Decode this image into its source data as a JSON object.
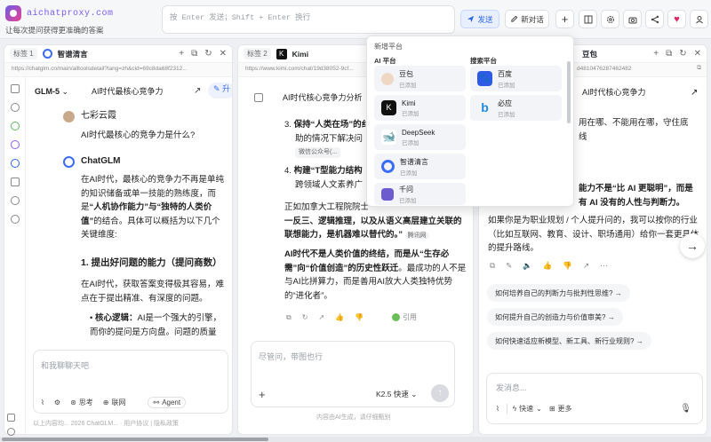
{
  "header": {
    "brand": "aichatproxy.com",
    "tagline": "让每次提问获得更准确的答案",
    "prompt_placeholder": "按 Enter 发送；Shift + Enter 换行",
    "send_label": "发送",
    "new_chat_label": "新对话"
  },
  "dropdown": {
    "title": "新增平台",
    "ai_section": "AI 平台",
    "search_section": "搜索平台",
    "ai_items": [
      {
        "name": "豆包",
        "status": "已添加"
      },
      {
        "name": "Kimi",
        "status": "已添加"
      },
      {
        "name": "DeepSeek",
        "status": "已添加"
      },
      {
        "name": "智谱清言",
        "status": "已添加"
      },
      {
        "name": "千问",
        "status": "已添加"
      }
    ],
    "search_items": [
      {
        "name": "百度",
        "status": "已添加"
      },
      {
        "name": "必应",
        "status": "已添加"
      }
    ]
  },
  "panel1": {
    "tag": "标签 1",
    "title": "智谱清言",
    "url": "https://chatglm.cn/main/alltoolsdetail?lang=zh&cid=69c8da68f2312...",
    "model": "GLM-5",
    "conv_title": "AI时代最核心竞争力",
    "user_name": "七彩云霞",
    "user_question": "AI时代最核心的竞争力是什么?",
    "bot_name": "ChatGLM",
    "p1_a": "在AI时代，最核心的竞争力不再是单纯的知识储备或单一技能的熟练度，而是",
    "p1_b": "“人机协作能力”与“独特的人类价值”",
    "p1_c": "的结合。具体可以概括为以下几个关键维度:",
    "h1": "1. 提出好问题的能力（提问商数）",
    "p2": "在AI时代，获取答案变得极其容易，难点在于提出精准、有深度的问题。",
    "bullet_label": "核心逻辑：",
    "bullet_text": "AI是一个强大的引擎，而你的提问是方向盘。问题的质量",
    "input_placeholder": "和我聊聊天吧",
    "chip_think": "思考",
    "chip_web": "联网",
    "chip_agent": "Agent",
    "footer": "以上内容均... 2026 ChatGLM... · 用户协议 | 隐私政策"
  },
  "panel2": {
    "tag": "标签 2",
    "title": "Kimi",
    "url": "https://www.kimi.com/chat/19d38052-9cf...",
    "conv_title": "AI时代核心竞争力分析",
    "item3_bold": "保持“人类在场”的纟",
    "item3_rest": "助的情况下解决问",
    "cite1": "微信公众号(...",
    "item4_bold": "构建“T型能力结构",
    "item4_rest": "跨领域人文素养广",
    "para1_a": "正如加拿大工程院院士",
    "para1_b": "一反三、逻辑推理，以及从语义高层建立关联的联想能力，是机器难以替代的。”",
    "cite2": "腾讯网",
    "para2_a": "AI时代不是人类价值的终结，而是从“生存必需”向“价值创造”的历史性跃迁",
    "para2_b": "。最成功的人不是与AI比拼算力，而是善用AI放大人类独特优势的“进化者”。",
    "cite_label": "引用",
    "input_placeholder": "尽管问，带图也行",
    "model": "K2.5 快速",
    "footer": "内容由AI生成，请仔细甄别"
  },
  "panel3": {
    "tag": "标签 3",
    "title": "豆包",
    "url": "d4810476287462482",
    "conv_title": "AI时代核心竞争力",
    "line1": "用在哪、不能用在哪，守住底",
    "line2": "线",
    "bold1": "能力不是“比 AI 更聪明”，而是",
    "bold2": "有 AI 没有的人性与判断力。",
    "para": "如果你是为职业规划 / 个人提升问的，我可以按你的行业（比如互联网、教育、设计、职场通用）给你一套更具体的提升路线。",
    "suggestions": [
      "如何培养自己的判断力与批判性思维?",
      "如何提升自己的创造力与价值审美?",
      "如何快速适应新模型、新工具、新行业规则?"
    ],
    "input_placeholder": "发消息...",
    "chip_fast": "快速",
    "chip_more": "更多"
  }
}
